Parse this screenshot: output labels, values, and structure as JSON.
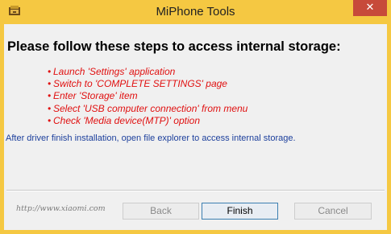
{
  "window": {
    "title": "MiPhone Tools",
    "close_glyph": "✕",
    "app_icon": "miphone-tools-app-icon"
  },
  "main": {
    "heading": "Please follow these steps to access internal storage:",
    "bullet_glyph": "•",
    "steps": [
      "Launch 'Settings' application",
      "Switch to 'COMPLETE SETTINGS' page",
      "Enter 'Storage' item",
      "Select 'USB computer connection' from menu",
      "Check 'Media device(MTP)' option"
    ],
    "after_note": "After driver finish installation, open file explorer to access internal storage."
  },
  "footer": {
    "url": "http://www.xiaomi.com",
    "back_label": "Back",
    "finish_label": "Finish",
    "cancel_label": "Cancel",
    "back_enabled": false,
    "cancel_enabled": false
  },
  "colors": {
    "window_frame": "#f5c842",
    "close_button": "#c74a3a",
    "step_text": "#e01010",
    "note_text": "#1c3f9c",
    "url_text": "#7b7b7b"
  }
}
